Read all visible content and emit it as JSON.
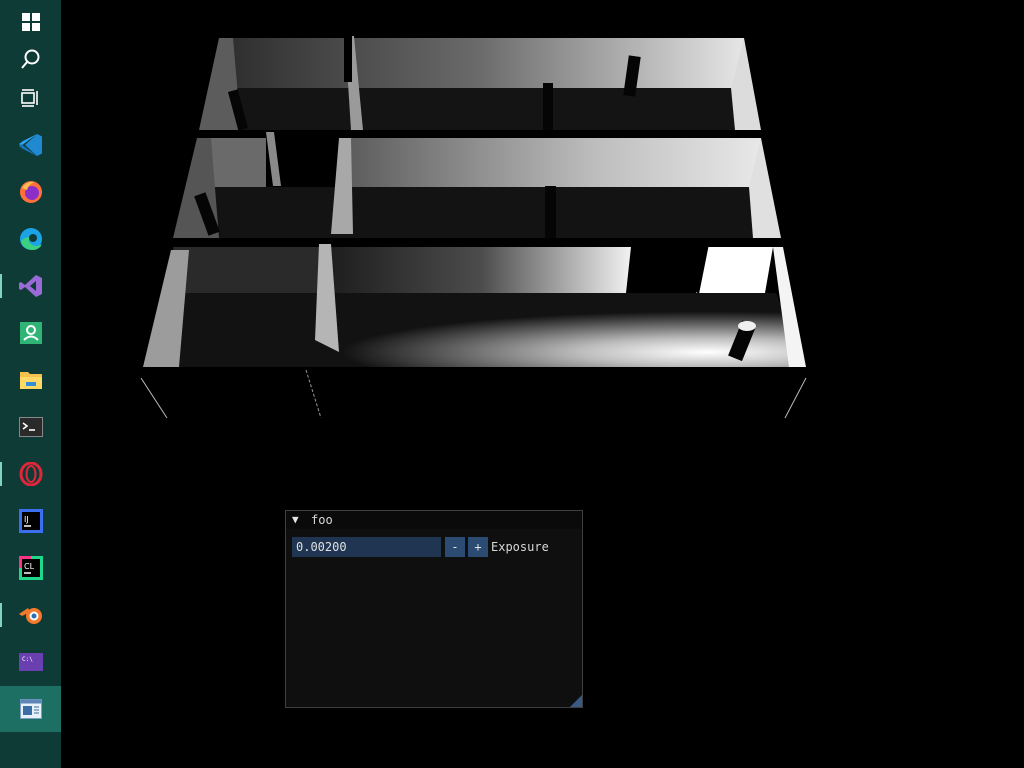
{
  "taskbar": {
    "icons": [
      {
        "name": "windows-start-icon",
        "active": false
      },
      {
        "name": "search-icon",
        "active": false
      },
      {
        "name": "task-view-icon",
        "active": false
      },
      {
        "name": "vscode-icon",
        "active": false
      },
      {
        "name": "firefox-icon",
        "active": false
      },
      {
        "name": "edge-icon",
        "active": false
      },
      {
        "name": "visual-studio-icon",
        "active": false
      },
      {
        "name": "contacts-app-icon",
        "active": false
      },
      {
        "name": "file-explorer-icon",
        "active": false
      },
      {
        "name": "terminal-icon",
        "active": false
      },
      {
        "name": "opera-icon",
        "active": false
      },
      {
        "name": "intellij-icon",
        "active": false
      },
      {
        "name": "clion-icon",
        "active": false
      },
      {
        "name": "blender-icon",
        "active": false
      },
      {
        "name": "dev-console-icon",
        "active": false
      },
      {
        "name": "running-app-icon",
        "active": true
      }
    ],
    "colors": {
      "background": "#0f3b37",
      "active": "#1d6f63"
    }
  },
  "scene": {
    "description_colors": {
      "background": "#000000",
      "wall_light": "#f5f5f5",
      "wall_dark": "#1a1a1a"
    }
  },
  "imgui_window": {
    "title": "foo",
    "input": {
      "value": "0.00200"
    },
    "minus_label": "-",
    "plus_label": "+",
    "label": "Exposure"
  }
}
